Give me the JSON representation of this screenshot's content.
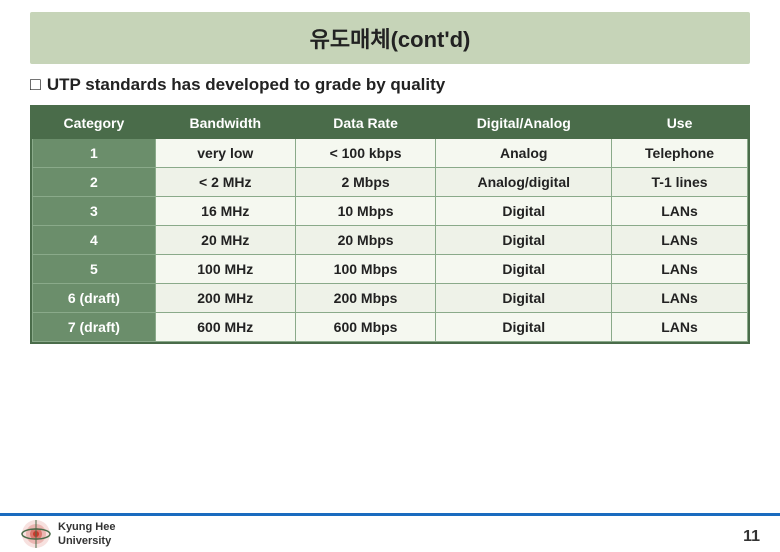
{
  "title": "유도매체(cont'd)",
  "subtitle": "UTP standards has developed to grade by quality",
  "subtitle_bullet": "□",
  "table": {
    "headers": [
      "Category",
      "Bandwidth",
      "Data Rate",
      "Digital/Analog",
      "Use"
    ],
    "rows": [
      [
        "1",
        "very low",
        "< 100 kbps",
        "Analog",
        "Telephone"
      ],
      [
        "2",
        "< 2 MHz",
        "2 Mbps",
        "Analog/digital",
        "T-1 lines"
      ],
      [
        "3",
        "16 MHz",
        "10 Mbps",
        "Digital",
        "LANs"
      ],
      [
        "4",
        "20 MHz",
        "20 Mbps",
        "Digital",
        "LANs"
      ],
      [
        "5",
        "100 MHz",
        "100 Mbps",
        "Digital",
        "LANs"
      ],
      [
        "6 (draft)",
        "200 MHz",
        "200 Mbps",
        "Digital",
        "LANs"
      ],
      [
        "7 (draft)",
        "600 MHz",
        "600 Mbps",
        "Digital",
        "LANs"
      ]
    ]
  },
  "footer": {
    "university_name_line1": "Kyung Hee",
    "university_name_line2": "University",
    "page_number": "11"
  }
}
